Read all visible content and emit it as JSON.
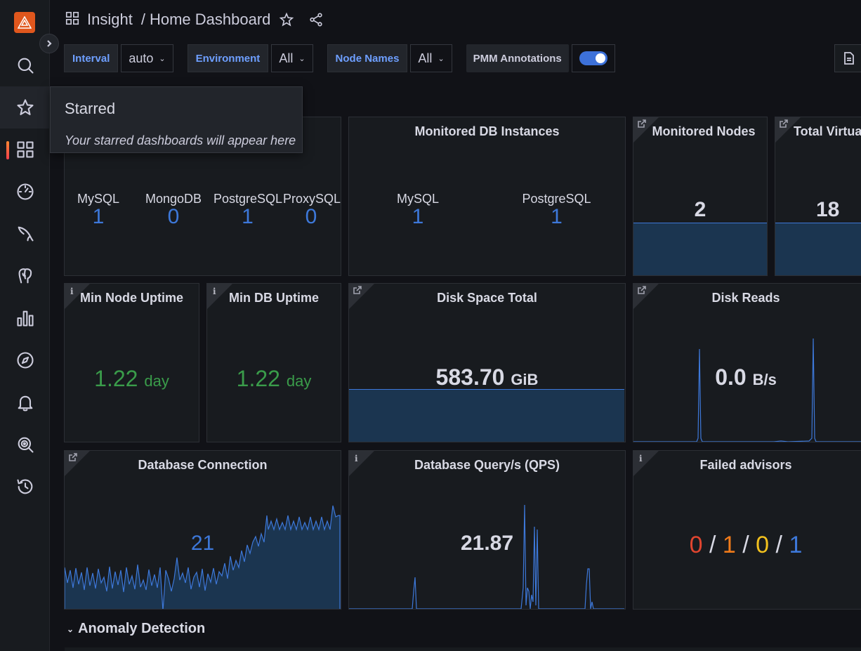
{
  "header": {
    "app": "Insight",
    "separator": "/",
    "dashboard": "Home Dashboard"
  },
  "variables": {
    "interval_label": "Interval",
    "interval_value": "auto",
    "environment_label": "Environment",
    "environment_value": "All",
    "node_names_label": "Node Names",
    "node_names_value": "All",
    "annotations_label": "PMM Annotations",
    "annotations_enabled": true
  },
  "tooltip": {
    "title": "Starred",
    "body": "Your starred dashboards will appear here"
  },
  "panels": {
    "db_services": {
      "items": [
        {
          "label": "MySQL",
          "value": "1"
        },
        {
          "label": "MongoDB",
          "value": "0"
        },
        {
          "label": "PostgreSQL",
          "value": "1"
        },
        {
          "label": "ProxySQL",
          "value": "0"
        }
      ]
    },
    "monitored_db": {
      "title": "Monitored DB Instances",
      "items": [
        {
          "label": "MySQL",
          "value": "1"
        },
        {
          "label": "PostgreSQL",
          "value": "1"
        }
      ]
    },
    "monitored_nodes": {
      "title": "Monitored Nodes",
      "value": "2",
      "fill_fraction": 0.33
    },
    "total_virtual": {
      "title": "Total Virtual",
      "value": "18",
      "fill_fraction": 0.33
    },
    "min_node_uptime": {
      "title": "Min Node Uptime",
      "value": "1.22",
      "unit": "day"
    },
    "min_db_uptime": {
      "title": "Min DB Uptime",
      "value": "1.22",
      "unit": "day"
    },
    "disk_space": {
      "title": "Disk Space Total",
      "value": "583.70",
      "unit": "GiB",
      "fill_fraction": 0.33
    },
    "disk_reads": {
      "title": "Disk Reads",
      "value": "0.0",
      "unit": "B/s"
    },
    "db_connection": {
      "title": "Database Connection",
      "value": "21"
    },
    "db_qps": {
      "title": "Database Query/s (QPS)",
      "value": "21.87"
    },
    "failed_advisors": {
      "title": "Failed advisors",
      "critical": "0",
      "error": "1",
      "warning": "0",
      "notice": "1",
      "sep": "/"
    }
  },
  "rows": {
    "anomaly_detection": "Anomaly Detection"
  },
  "colors": {
    "accent": "#3d78d9",
    "green": "#3a9c4a",
    "red": "#e0452f",
    "orange": "#f07b1a",
    "yellow": "#f2c11e",
    "blue": "#3d78d9"
  },
  "icons": [
    "search-icon",
    "star-icon",
    "dashboards-icon",
    "gauge-icon",
    "mysql-icon",
    "postgresql-icon",
    "bar-chart-icon",
    "compass-icon",
    "bell-icon",
    "advisor-icon",
    "history-icon"
  ]
}
